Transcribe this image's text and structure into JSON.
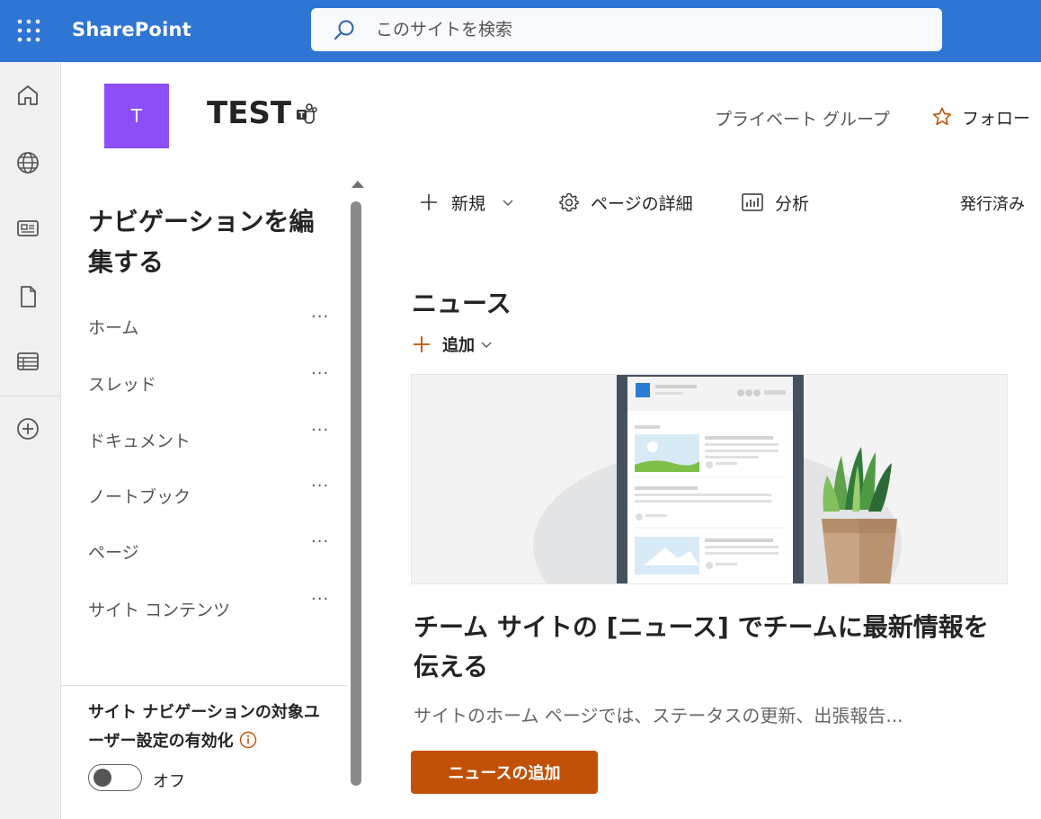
{
  "topbar": {
    "brand": "SharePoint",
    "search_placeholder": "このサイトを検索"
  },
  "rail": {
    "icons": [
      "home-icon",
      "globe-icon",
      "news-icon",
      "document-icon",
      "list-icon",
      "add-icon"
    ]
  },
  "site": {
    "logo_letter": "T",
    "title": "TEST",
    "group_type": "プライベート グループ",
    "follow_label": "フォロー"
  },
  "nav": {
    "heading": "ナビゲーションを編集する",
    "items": [
      {
        "label": "ホーム"
      },
      {
        "label": "スレッド"
      },
      {
        "label": "ドキュメント"
      },
      {
        "label": "ノートブック"
      },
      {
        "label": "ページ"
      },
      {
        "label": "サイト コンテンツ"
      }
    ],
    "more_label": "···",
    "audience_label": "サイト ナビゲーションの対象ユーザー設定の有効化",
    "toggle_state": "オフ"
  },
  "commandbar": {
    "new_label": "新規",
    "page_details_label": "ページの詳細",
    "analytics_label": "分析",
    "status": "発行済み"
  },
  "news": {
    "title": "ニュース",
    "add_label": "追加",
    "promo_title": "チーム サイトの [ニュース] でチームに最新情報を伝える",
    "promo_desc": "サイトのホーム ページでは、ステータスの更新、出張報告...",
    "add_button": "ニュースの追加"
  },
  "colors": {
    "suite_bar": "#2f76d4",
    "logo": "#8c4ff7",
    "accent": "#c15106"
  }
}
